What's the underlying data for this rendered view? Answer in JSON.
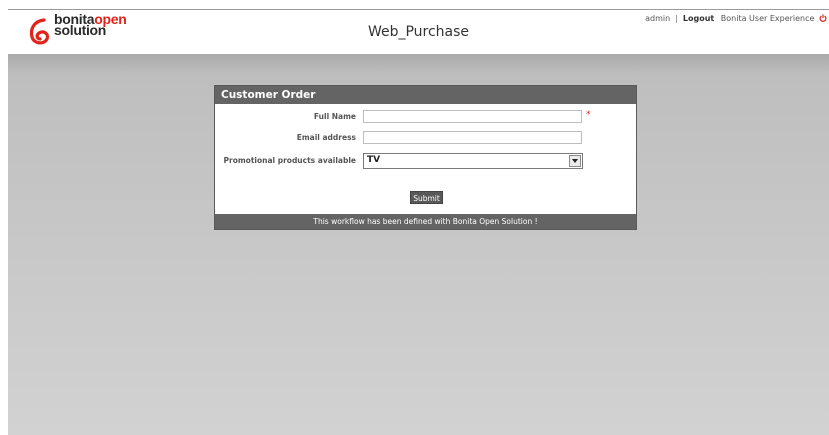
{
  "header": {
    "logo_text_1": "bonita",
    "logo_text_2": "open",
    "logo_text_3": "solution",
    "app_title": "Web_Purchase",
    "user": "admin",
    "separator": "|",
    "logout_label": "Logout",
    "user_experience_label": "Bonita User Experience",
    "icons": {
      "logo": "bonita-swirl-logo-icon",
      "power": "power-icon"
    }
  },
  "form": {
    "title": "Customer Order",
    "fields": [
      {
        "label": "Full Name",
        "value": "",
        "required_marker": "*"
      },
      {
        "label": "Email address",
        "value": ""
      }
    ],
    "promo": {
      "label": "Promotional products available",
      "selected": "TV"
    },
    "submit_label": "Submit",
    "footer": "This workflow has been defined with Bonita Open Solution !"
  },
  "colors": {
    "accent_red": "#e2231a",
    "panel_dark": "#646464",
    "background_gray": "#c4c4c4"
  }
}
